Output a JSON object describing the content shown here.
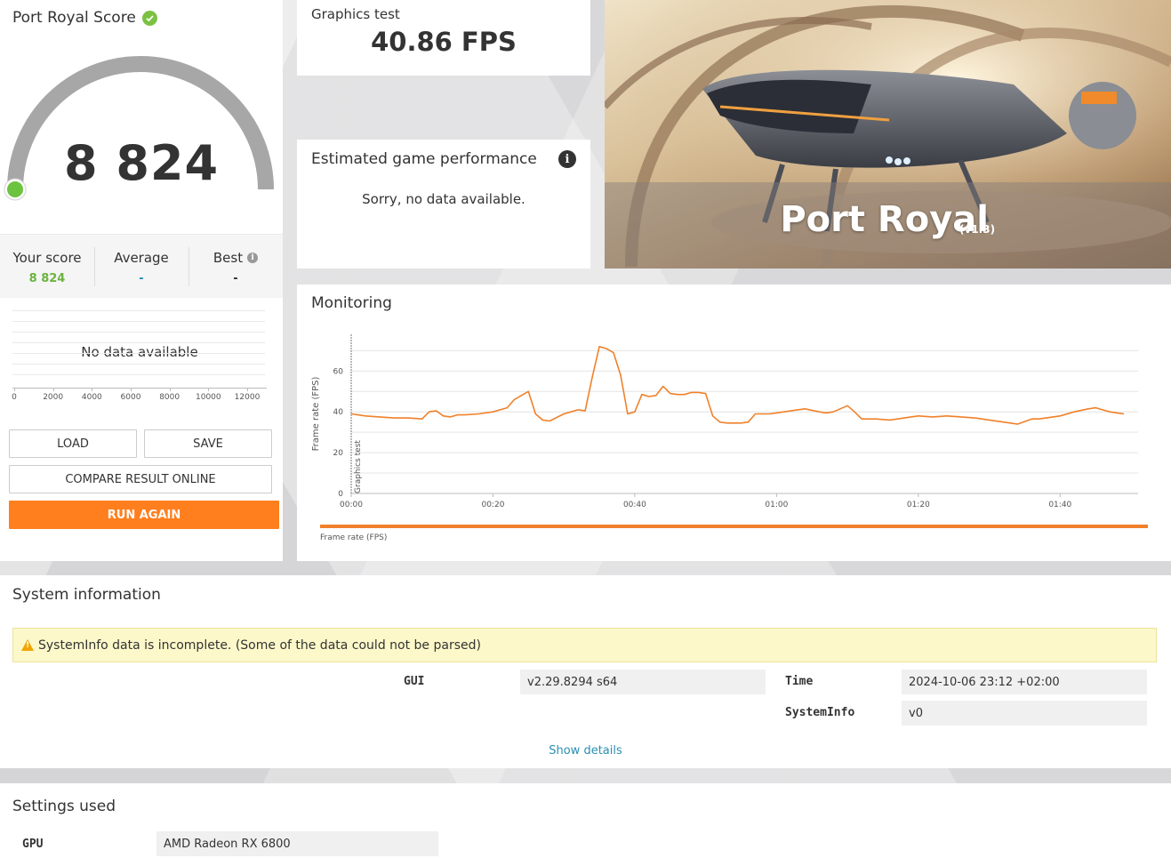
{
  "score": {
    "title": "Port Royal Score",
    "value": "8 824",
    "fraction": 0.0,
    "your_score_label": "Your score",
    "your_score_value": "8 824",
    "average_label": "Average",
    "average_value": "-",
    "best_label": "Best",
    "best_value": "-",
    "no_data": "No data available",
    "dist_ticks": [
      "0",
      "2000",
      "4000",
      "6000",
      "8000",
      "10000",
      "12000"
    ]
  },
  "buttons": {
    "load": "LOAD",
    "save": "SAVE",
    "compare": "COMPARE RESULT ONLINE",
    "run_again": "RUN AGAIN"
  },
  "graphics_test": {
    "label": "Graphics test",
    "value": "40.86 FPS"
  },
  "estimated": {
    "title": "Estimated game performance",
    "message": "Sorry, no data available."
  },
  "hero": {
    "title": "Port Royal",
    "version": "(v1.3)"
  },
  "monitoring": {
    "title": "Monitoring",
    "legend": "Frame rate (FPS)"
  },
  "system_info": {
    "title": "System information",
    "warning": "SystemInfo data is incomplete. (Some of the data could not be parsed)",
    "fields": [
      {
        "label": "GUI",
        "value": "v2.29.8294 s64"
      },
      {
        "label": "Time",
        "value": "2024-10-06 23:12 +02:00"
      },
      {
        "label": "SystemInfo",
        "value": "v0"
      }
    ],
    "show_details": "Show details"
  },
  "settings": {
    "title": "Settings used",
    "fields": [
      {
        "label": "GPU",
        "value": "AMD Radeon RX 6800"
      }
    ]
  },
  "colors": {
    "accent": "#ff7f1e",
    "series": "#f0812a",
    "score_green": "#7cc242",
    "link": "#2b8fb3"
  },
  "chart_data": {
    "type": "line",
    "title": "",
    "xlabel": "",
    "ylabel": "Frame rate (FPS)",
    "annotation": "Graphics test",
    "x_ticks": [
      "00:00",
      "00:20",
      "00:40",
      "01:00",
      "01:20",
      "01:40"
    ],
    "y_ticks": [
      "0",
      "20",
      "40",
      "60"
    ],
    "xlim": [
      0,
      111
    ],
    "ylim": [
      0,
      78
    ],
    "series": [
      {
        "name": "Frame rate (FPS)",
        "x": [
          0,
          2,
          4,
          6,
          8,
          10,
          11,
          12,
          13,
          14,
          15,
          16,
          18,
          20,
          22,
          23,
          24,
          25,
          26,
          27,
          28,
          30,
          31,
          32,
          33,
          34,
          35,
          36,
          37,
          38,
          39,
          40,
          41,
          42,
          43,
          44,
          45,
          46,
          47,
          48,
          49,
          50,
          51,
          52,
          53,
          54,
          55,
          56,
          57,
          58,
          59,
          60,
          62,
          64,
          66,
          67,
          68,
          70,
          71,
          72,
          73,
          74,
          76,
          78,
          80,
          82,
          84,
          86,
          88,
          90,
          92,
          94,
          96,
          97,
          98,
          100,
          102,
          104,
          105,
          106,
          107,
          108,
          109
        ],
        "y": [
          39,
          38,
          37.5,
          37,
          37,
          36.5,
          40,
          40.5,
          38,
          37.5,
          38.5,
          38.5,
          39,
          40,
          42,
          46,
          48,
          50,
          39,
          36,
          35.5,
          39,
          40,
          41,
          40.5,
          57,
          72,
          71,
          69,
          58,
          39,
          40,
          48.5,
          47.5,
          48,
          52.5,
          49,
          48.5,
          48.5,
          49.5,
          49.5,
          49,
          38,
          35,
          34.5,
          34.5,
          34.5,
          35,
          39,
          39,
          39,
          39.5,
          40.5,
          41.5,
          40,
          39.5,
          40,
          43,
          40,
          36.5,
          36.5,
          36.5,
          36,
          37,
          38,
          37.5,
          38,
          37.5,
          37,
          36,
          35,
          34,
          36.5,
          36.5,
          37,
          38,
          40,
          41.5,
          42,
          41,
          40,
          39.5,
          39
        ]
      }
    ]
  }
}
